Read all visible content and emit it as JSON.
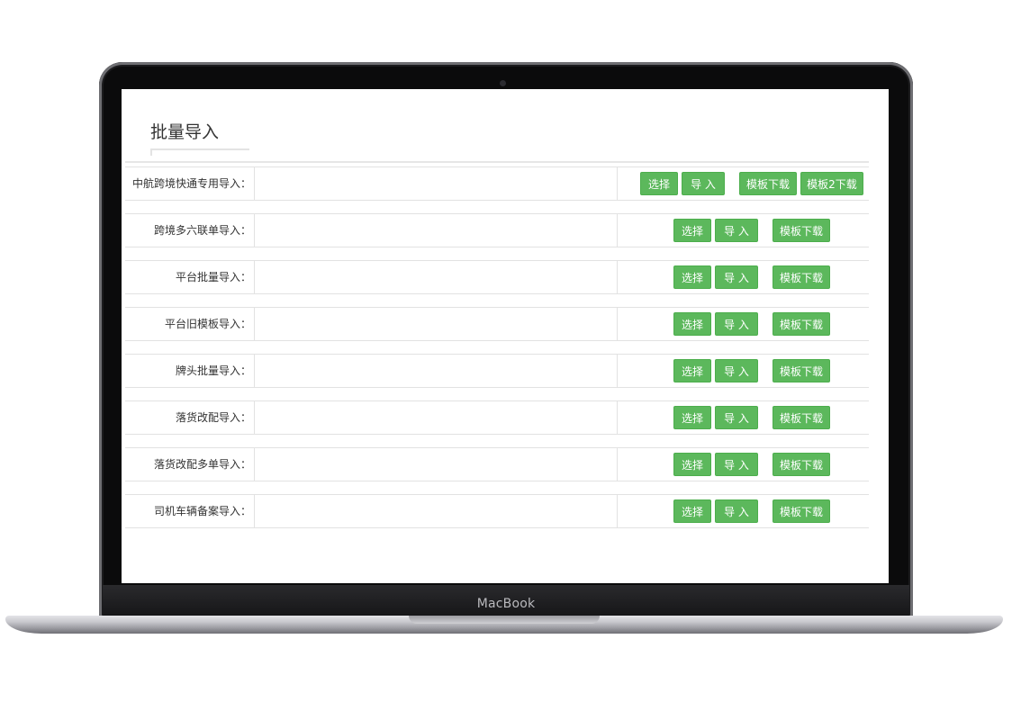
{
  "device": {
    "brand": "MacBook"
  },
  "page": {
    "title": "批量导入"
  },
  "colors": {
    "button_bg": "#5cb85c",
    "button_border": "#4cae4c",
    "button_text": "#ffffff"
  },
  "buttons": {
    "choose": "选择",
    "import": "导 入",
    "template_download": "模板下载",
    "template2_download": "模板2下载"
  },
  "rows": [
    {
      "label": "中航跨境快通专用导入："
    },
    {
      "label": "跨境多六联单导入："
    },
    {
      "label": "平台批量导入："
    },
    {
      "label": "平台旧模板导入："
    },
    {
      "label": "牌头批量导入："
    },
    {
      "label": "落货改配导入："
    },
    {
      "label": "落货改配多单导入："
    },
    {
      "label": "司机车辆备案导入："
    }
  ]
}
